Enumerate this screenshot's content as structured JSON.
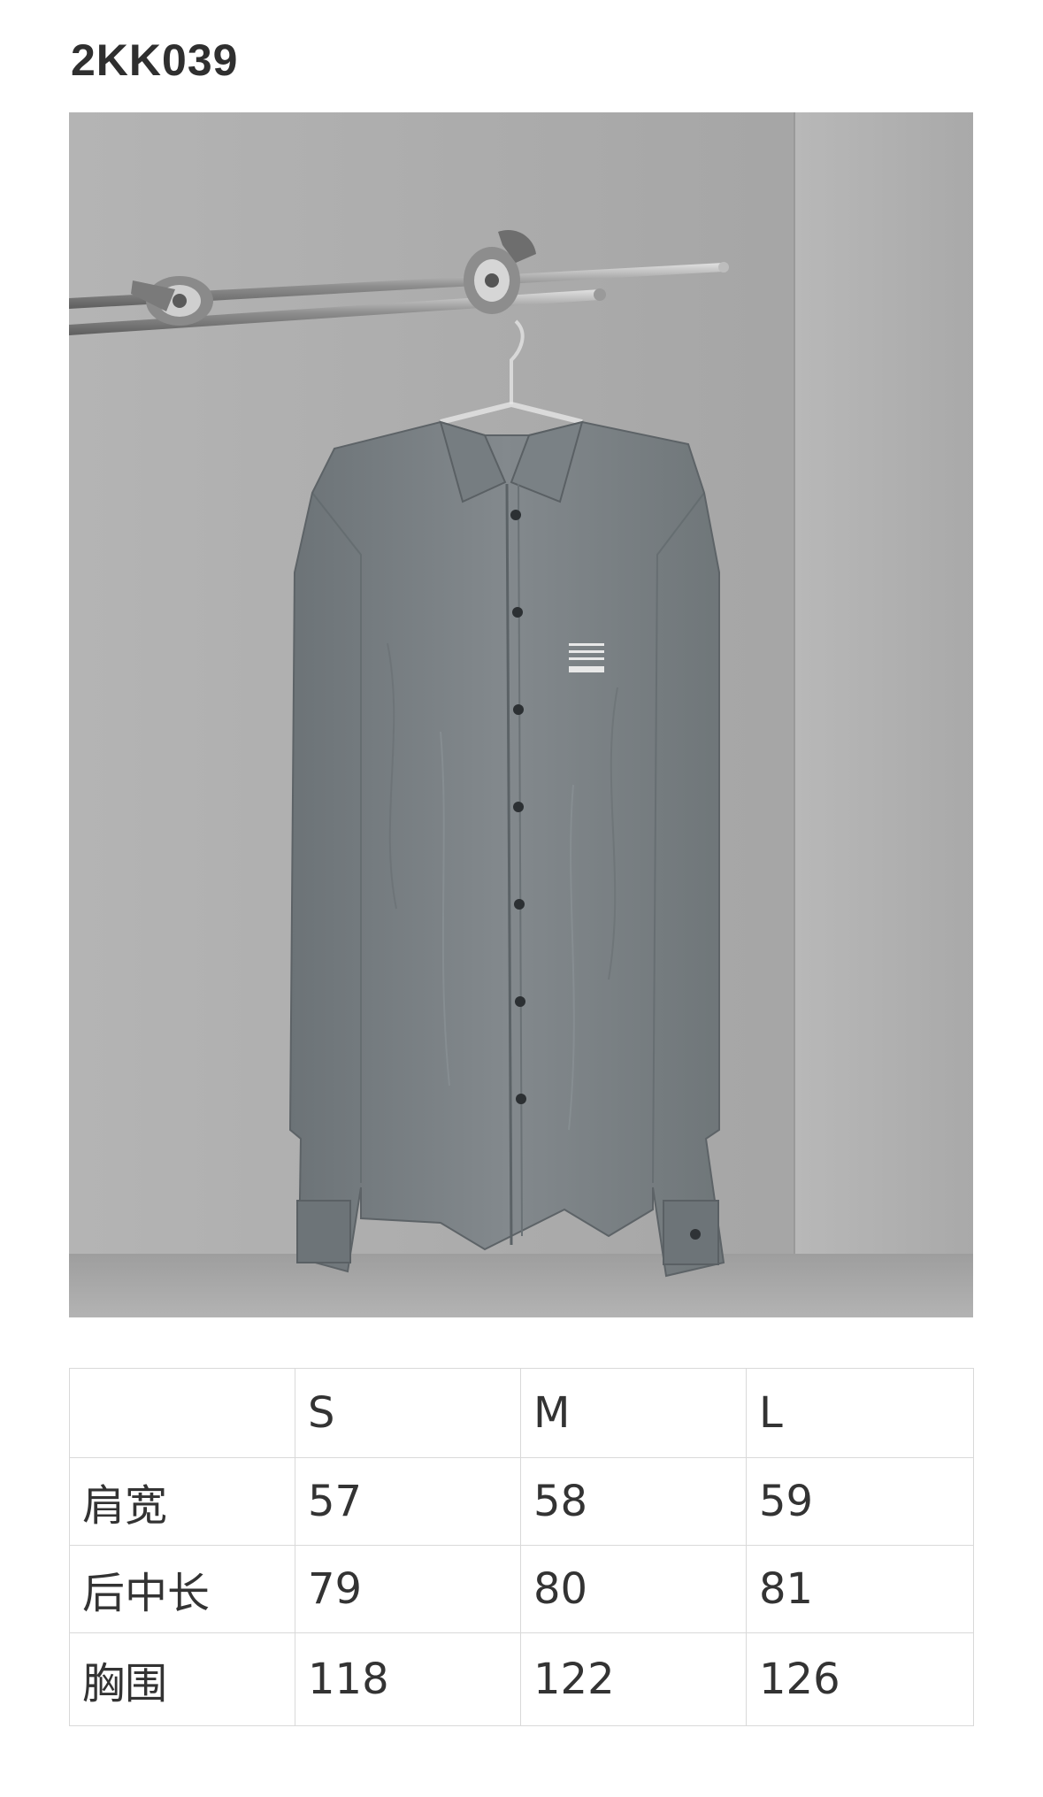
{
  "product": {
    "code": "2KK039"
  },
  "size_table": {
    "columns": [
      "",
      "S",
      "M",
      "L"
    ],
    "rows": [
      {
        "label": "肩宽",
        "values": [
          "57",
          "58",
          "59"
        ]
      },
      {
        "label": "后中长",
        "values": [
          "79",
          "80",
          "81"
        ]
      },
      {
        "label": "胸围",
        "values": [
          "118",
          "122",
          "126"
        ]
      }
    ]
  },
  "colors": {
    "shirt": "#7d8488",
    "wall": "#a9a9a9",
    "border": "#d9d9d9"
  }
}
